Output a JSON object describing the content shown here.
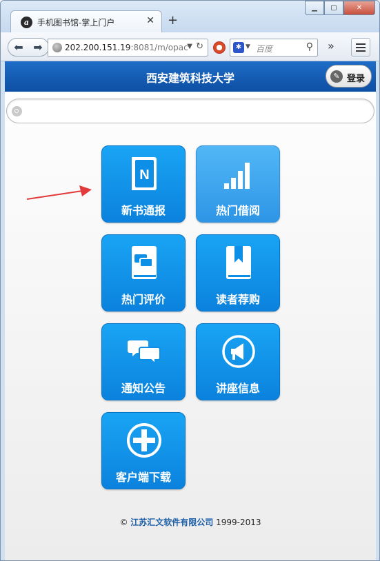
{
  "browser": {
    "tab_title": "手机图书馆-掌上门户",
    "tab_icon_letter": "a",
    "url_host": "202.200.151.19",
    "url_rest": ":8081/m/opac",
    "search_placeholder": "百度"
  },
  "page": {
    "header_title": "西安建筑科技大学",
    "login_label": "登录",
    "tiles": [
      {
        "label": "新书通报",
        "icon": "new-book-icon"
      },
      {
        "label": "热门借阅",
        "icon": "bar-chart-icon"
      },
      {
        "label": "热门评价",
        "icon": "book-comment-icon"
      },
      {
        "label": "读者荐购",
        "icon": "bookmark-book-icon"
      },
      {
        "label": "通知公告",
        "icon": "chat-bubbles-icon"
      },
      {
        "label": "讲座信息",
        "icon": "megaphone-icon"
      },
      {
        "label": "客户端下载",
        "icon": "plus-circle-icon"
      }
    ],
    "footer": {
      "copyright": "©",
      "company": "江苏汇文软件有限公司",
      "years": "1999-2013"
    }
  },
  "colors": {
    "header": "#1565c0",
    "tile": "#0d8fe8",
    "tile_light": "#3ea6ee",
    "footer_company": "#1d5fa8",
    "arrow": "#e23a3a"
  }
}
